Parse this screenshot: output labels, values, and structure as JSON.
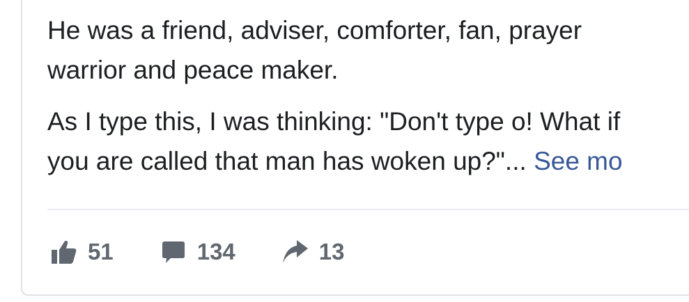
{
  "post": {
    "paragraph_1_line_1": "He was a friend, adviser, comforter, fan, prayer",
    "paragraph_1_line_2": "warrior and peace maker.",
    "paragraph_2_line_1": "As I type this, I was thinking: \"Don't type o! What if",
    "paragraph_2_line_2": "you are called that man has woken up?\"... ",
    "see_more_label": "See mo"
  },
  "actions": {
    "likes": "51",
    "comments": "134",
    "shares": "13",
    "icons": {
      "like": "thumbs-up-icon",
      "comment": "speech-bubble-icon",
      "share": "share-arrow-icon"
    }
  },
  "colors": {
    "text": "#1c1e21",
    "link": "#385898",
    "muted": "#606770",
    "divider": "#e9ebee"
  }
}
